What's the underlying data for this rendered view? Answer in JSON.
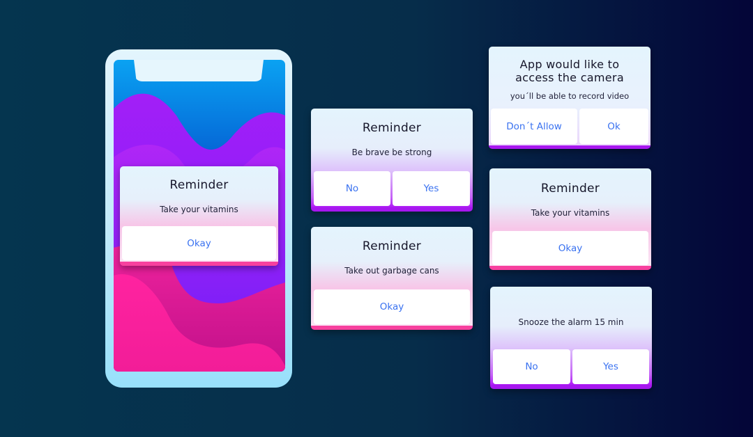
{
  "colors": {
    "button_text": "#3a72f0",
    "title_text": "#16162a",
    "pink_accent": "#f7409e",
    "purple_accent": "#a717ef"
  },
  "phone": {
    "dialog": {
      "title": "Reminder",
      "message": "Take your vitamins",
      "buttons": [
        "Okay"
      ]
    }
  },
  "dialogs": [
    {
      "id": "brave",
      "title": "Reminder",
      "message": "Be brave be strong",
      "buttons": [
        "No",
        "Yes"
      ]
    },
    {
      "id": "garbage",
      "title": "Reminder",
      "message": "Take out garbage cans",
      "buttons": [
        "Okay"
      ]
    },
    {
      "id": "camera",
      "title_line1": "App would like to",
      "title_line2": "access the camera",
      "message": "you´ll be able to record video",
      "buttons": [
        "Don´t Allow",
        "Ok"
      ]
    },
    {
      "id": "vitamins",
      "title": "Reminder",
      "message": "Take your vitamins",
      "buttons": [
        "Okay"
      ]
    },
    {
      "id": "snooze",
      "message": "Snooze the alarm 15 min",
      "buttons": [
        "No",
        "Yes"
      ]
    }
  ]
}
